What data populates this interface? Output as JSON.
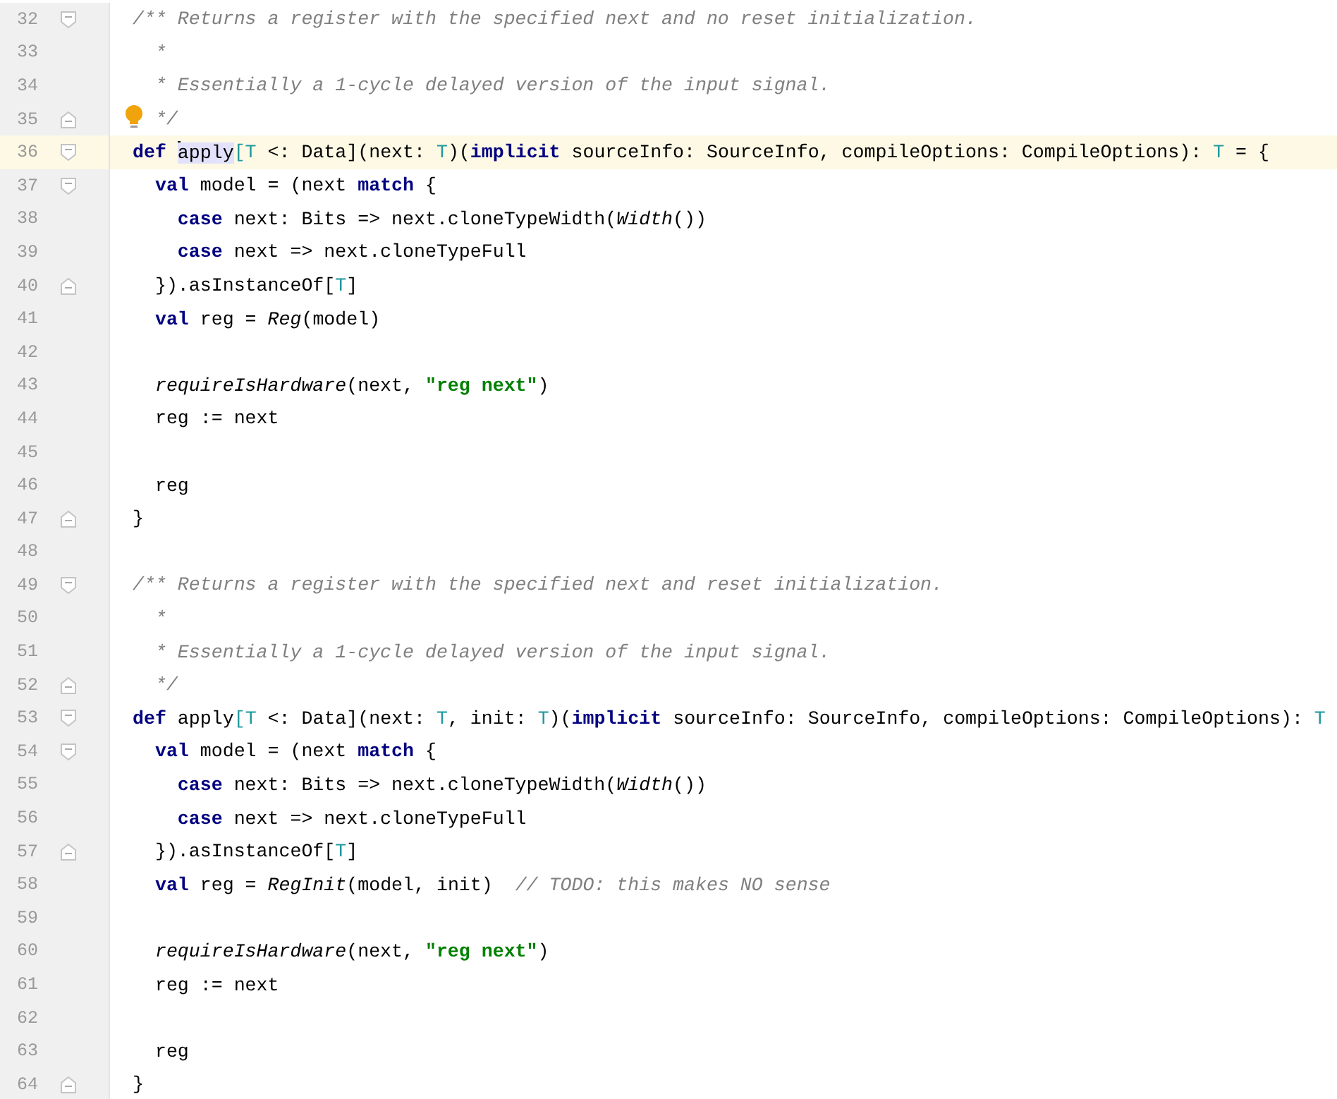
{
  "editor": {
    "lines": [
      {
        "number": "32",
        "fold": {
          "kind": "start"
        },
        "tokens": [
          {
            "kind": "comment",
            "text": "/** Returns a register with the specified next and no reset initialization."
          }
        ]
      },
      {
        "number": "33",
        "tokens": [
          {
            "kind": "comment",
            "text": "  *"
          }
        ]
      },
      {
        "number": "34",
        "tokens": [
          {
            "kind": "comment",
            "text": "  * Essentially a 1-cycle delayed version of the input signal."
          }
        ]
      },
      {
        "number": "35",
        "fold": {
          "kind": "end"
        },
        "bulb": true,
        "tokens": [
          {
            "kind": "comment",
            "text": "  */"
          }
        ]
      },
      {
        "number": "36",
        "fold": {
          "kind": "start"
        },
        "current": true,
        "tokens": [
          {
            "kind": "keyword",
            "text": "def "
          },
          {
            "kind": "plain",
            "text": "apply",
            "selected": true,
            "caret": true
          },
          {
            "kind": "type",
            "text": "[T"
          },
          {
            "kind": "plain",
            "text": " <: Data](next: "
          },
          {
            "kind": "type",
            "text": "T"
          },
          {
            "kind": "plain",
            "text": ")("
          },
          {
            "kind": "keyword",
            "text": "implicit"
          },
          {
            "kind": "plain",
            "text": " sourceInfo: SourceInfo, compileOptions: CompileOptions): "
          },
          {
            "kind": "type",
            "text": "T"
          },
          {
            "kind": "plain",
            "text": " = {"
          }
        ]
      },
      {
        "number": "37",
        "fold": {
          "kind": "start"
        },
        "tokens": [
          {
            "kind": "keyword",
            "text": "  val"
          },
          {
            "kind": "plain",
            "text": " model = (next "
          },
          {
            "kind": "keyword",
            "text": "match"
          },
          {
            "kind": "plain",
            "text": " {"
          }
        ]
      },
      {
        "number": "38",
        "tokens": [
          {
            "kind": "keyword",
            "text": "    case"
          },
          {
            "kind": "plain",
            "text": " next: Bits => next.cloneTypeWidth("
          },
          {
            "kind": "call",
            "text": "Width"
          },
          {
            "kind": "plain",
            "text": "())"
          }
        ]
      },
      {
        "number": "39",
        "tokens": [
          {
            "kind": "keyword",
            "text": "    case"
          },
          {
            "kind": "plain",
            "text": " next => next.cloneTypeFull"
          }
        ]
      },
      {
        "number": "40",
        "fold": {
          "kind": "end"
        },
        "tokens": [
          {
            "kind": "plain",
            "text": "  }).asInstanceOf["
          },
          {
            "kind": "type",
            "text": "T"
          },
          {
            "kind": "plain",
            "text": "]"
          }
        ]
      },
      {
        "number": "41",
        "tokens": [
          {
            "kind": "keyword",
            "text": "  val"
          },
          {
            "kind": "plain",
            "text": " reg = "
          },
          {
            "kind": "call",
            "text": "Reg"
          },
          {
            "kind": "plain",
            "text": "(model)"
          }
        ]
      },
      {
        "number": "42"
      },
      {
        "number": "43",
        "tokens": [
          {
            "kind": "call",
            "text": "  requireIsHardware"
          },
          {
            "kind": "plain",
            "text": "(next, "
          },
          {
            "kind": "string",
            "text": "\"reg next\""
          },
          {
            "kind": "plain",
            "text": ")"
          }
        ]
      },
      {
        "number": "44",
        "tokens": [
          {
            "kind": "plain",
            "text": "  reg := next"
          }
        ]
      },
      {
        "number": "45"
      },
      {
        "number": "46",
        "tokens": [
          {
            "kind": "plain",
            "text": "  reg"
          }
        ]
      },
      {
        "number": "47",
        "fold": {
          "kind": "end"
        },
        "tokens": [
          {
            "kind": "plain",
            "text": "}"
          }
        ]
      },
      {
        "number": "48"
      },
      {
        "number": "49",
        "fold": {
          "kind": "start"
        },
        "tokens": [
          {
            "kind": "comment",
            "text": "/** Returns a register with the specified next and reset initialization."
          }
        ]
      },
      {
        "number": "50",
        "tokens": [
          {
            "kind": "comment",
            "text": "  *"
          }
        ]
      },
      {
        "number": "51",
        "tokens": [
          {
            "kind": "comment",
            "text": "  * Essentially a 1-cycle delayed version of the input signal."
          }
        ]
      },
      {
        "number": "52",
        "fold": {
          "kind": "end"
        },
        "tokens": [
          {
            "kind": "comment",
            "text": "  */"
          }
        ]
      },
      {
        "number": "53",
        "fold": {
          "kind": "start"
        },
        "tokens": [
          {
            "kind": "keyword",
            "text": "def"
          },
          {
            "kind": "plain",
            "text": " apply"
          },
          {
            "kind": "type",
            "text": "[T"
          },
          {
            "kind": "plain",
            "text": " <: Data](next: "
          },
          {
            "kind": "type",
            "text": "T"
          },
          {
            "kind": "plain",
            "text": ", init: "
          },
          {
            "kind": "type",
            "text": "T"
          },
          {
            "kind": "plain",
            "text": ")("
          },
          {
            "kind": "keyword",
            "text": "implicit"
          },
          {
            "kind": "plain",
            "text": " sourceInfo: SourceInfo, compileOptions: CompileOptions): "
          },
          {
            "kind": "type",
            "text": "T"
          }
        ]
      },
      {
        "number": "54",
        "fold": {
          "kind": "start"
        },
        "tokens": [
          {
            "kind": "keyword",
            "text": "  val"
          },
          {
            "kind": "plain",
            "text": " model = (next "
          },
          {
            "kind": "keyword",
            "text": "match"
          },
          {
            "kind": "plain",
            "text": " {"
          }
        ]
      },
      {
        "number": "55",
        "tokens": [
          {
            "kind": "keyword",
            "text": "    case"
          },
          {
            "kind": "plain",
            "text": " next: Bits => next.cloneTypeWidth("
          },
          {
            "kind": "call",
            "text": "Width"
          },
          {
            "kind": "plain",
            "text": "())"
          }
        ]
      },
      {
        "number": "56",
        "tokens": [
          {
            "kind": "keyword",
            "text": "    case"
          },
          {
            "kind": "plain",
            "text": " next => next.cloneTypeFull"
          }
        ]
      },
      {
        "number": "57",
        "fold": {
          "kind": "end"
        },
        "tokens": [
          {
            "kind": "plain",
            "text": "  }).asInstanceOf["
          },
          {
            "kind": "type",
            "text": "T"
          },
          {
            "kind": "plain",
            "text": "]"
          }
        ]
      },
      {
        "number": "58",
        "tokens": [
          {
            "kind": "keyword",
            "text": "  val"
          },
          {
            "kind": "plain",
            "text": " reg = "
          },
          {
            "kind": "call",
            "text": "RegInit"
          },
          {
            "kind": "plain",
            "text": "(model, init)  "
          },
          {
            "kind": "comment",
            "text": "// TODO: this makes NO sense"
          }
        ]
      },
      {
        "number": "59"
      },
      {
        "number": "60",
        "tokens": [
          {
            "kind": "call",
            "text": "  requireIsHardware"
          },
          {
            "kind": "plain",
            "text": "(next, "
          },
          {
            "kind": "string",
            "text": "\"reg next\""
          },
          {
            "kind": "plain",
            "text": ")"
          }
        ]
      },
      {
        "number": "61",
        "tokens": [
          {
            "kind": "plain",
            "text": "  reg := next"
          }
        ]
      },
      {
        "number": "62"
      },
      {
        "number": "63",
        "tokens": [
          {
            "kind": "plain",
            "text": "  reg"
          }
        ]
      },
      {
        "number": "64",
        "fold": {
          "kind": "end"
        },
        "tokens": [
          {
            "kind": "plain",
            "text": "}"
          }
        ]
      }
    ]
  }
}
